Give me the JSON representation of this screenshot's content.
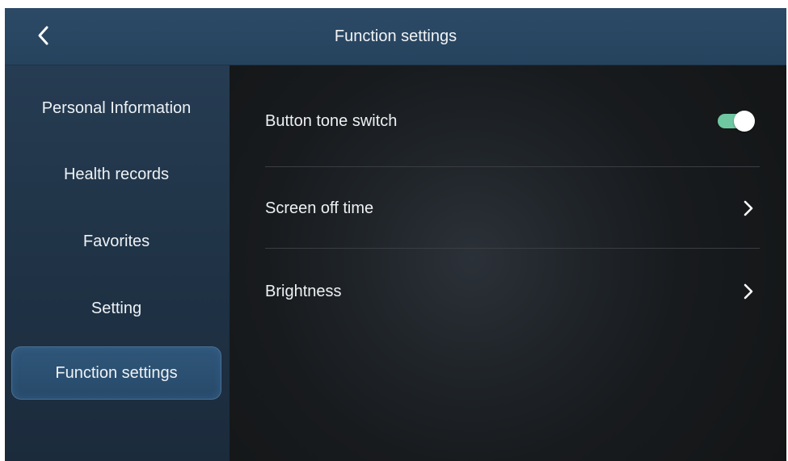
{
  "header": {
    "title": "Function settings",
    "back_icon": "chevron-left-icon"
  },
  "sidebar": {
    "items": [
      {
        "label": "Personal Information",
        "active": false
      },
      {
        "label": "Health records",
        "active": false
      },
      {
        "label": "Favorites",
        "active": false
      },
      {
        "label": "Setting",
        "active": false
      },
      {
        "label": "Function settings",
        "active": true
      }
    ]
  },
  "settings": {
    "button_tone": {
      "label": "Button tone switch",
      "enabled": true
    },
    "screen_off": {
      "label": "Screen off time",
      "icon": "chevron-right-icon"
    },
    "brightness": {
      "label": "Brightness",
      "icon": "chevron-right-icon"
    }
  },
  "colors": {
    "header_bg": "#2c4a66",
    "sidebar_bg": "#1f3245",
    "active_item_bg": "#2f5679",
    "toggle_on": "#6fc7a2",
    "content_bg": "#181b1e"
  }
}
